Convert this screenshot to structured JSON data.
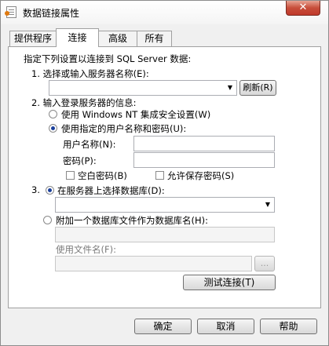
{
  "window": {
    "title": "数据链接属性",
    "close_glyph": "✕"
  },
  "tabs": [
    {
      "label": "提供程序"
    },
    {
      "label": "连接"
    },
    {
      "label": "高级"
    },
    {
      "label": "所有"
    }
  ],
  "connection": {
    "intro": "指定下列设置以连接到 SQL Server 数据:",
    "step1_label": "1. 选择或输入服务器名称(E):",
    "server_value": "",
    "refresh_label": "刷新(R)",
    "step2_label": "2. 输入登录服务器的信息:",
    "radio_windows_nt": "使用 Windows NT 集成安全设置(W)",
    "radio_specific_user": "使用指定的用户名称和密码(U):",
    "username_label": "用户名称(N):",
    "username_value": "",
    "password_label": "密码(P):",
    "password_value": "",
    "blank_password_label": "空白密码(B)",
    "allow_save_password_label": "允许保存密码(S)",
    "step3_label": "3.",
    "radio_select_db": "在服务器上选择数据库(D):",
    "database_value": "",
    "radio_attach_db": "附加一个数据库文件作为数据库名(H):",
    "attach_db_value": "",
    "filename_label": "使用文件名(F):",
    "filename_value": "",
    "browse_label": "...",
    "test_connection_label": "测试连接(T)"
  },
  "footer": {
    "ok_label": "确定",
    "cancel_label": "取消",
    "help_label": "帮助"
  }
}
